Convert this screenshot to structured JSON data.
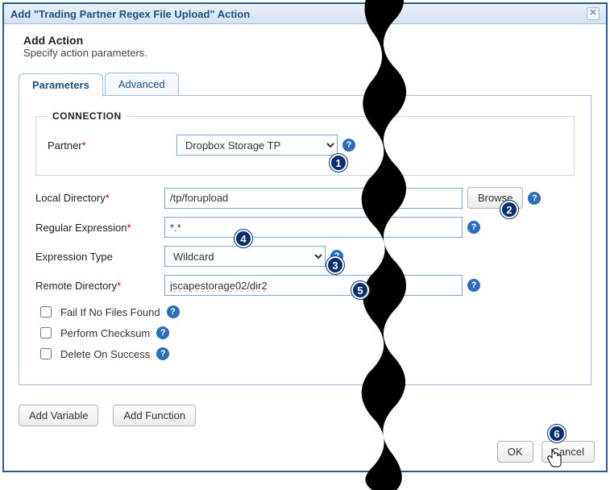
{
  "dialog": {
    "title": "Add \"Trading Partner Regex File Upload\" Action",
    "header": "Add Action",
    "subheader": "Specify action parameters."
  },
  "tabs": {
    "parameters": "Parameters",
    "advanced": "Advanced"
  },
  "legend": {
    "connection": "CONNECTION"
  },
  "labels": {
    "partner": "Partner",
    "local_directory": "Local Directory",
    "regex": "Regular Expression",
    "expr_type": "Expression Type",
    "remote_directory": "Remote Directory",
    "fail_if_none": "Fail If No Files Found",
    "perform_checksum": "Perform Checksum",
    "delete_on_success": "Delete On Success"
  },
  "values": {
    "partner": "Dropbox Storage TP",
    "local_directory": "/tp/forupload",
    "regex": "*.*",
    "expr_type": "Wildcard",
    "remote_directory": "jscapestorage02/dir2"
  },
  "buttons": {
    "browse": "Browse",
    "add_variable": "Add Variable",
    "add_function": "Add Function",
    "ok": "OK",
    "cancel": "Cancel"
  },
  "annotations": {
    "a1": "1",
    "a2": "2",
    "a3": "3",
    "a4": "4",
    "a5": "5",
    "a6": "6"
  }
}
